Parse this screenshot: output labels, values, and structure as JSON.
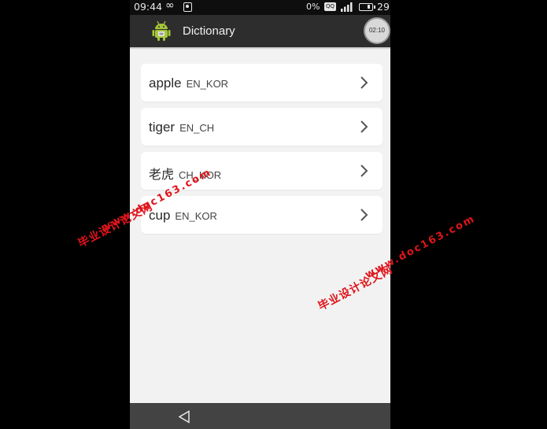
{
  "status_bar": {
    "time": "09:44",
    "infinity": "∞",
    "percent": "0%",
    "battery": "29",
    "msg_icon": "QQ"
  },
  "action_bar": {
    "title": "Dictionary",
    "timer": "02:10"
  },
  "list": {
    "items": [
      {
        "word": "apple",
        "lang": "EN_KOR"
      },
      {
        "word": "tiger",
        "lang": "EN_CH"
      },
      {
        "word": "老虎",
        "lang": "CH_KOR"
      },
      {
        "word": "cup",
        "lang": "EN_KOR"
      }
    ]
  },
  "watermarks": {
    "site_cn": "毕业设计论文网",
    "site_url": "www.doc163.com"
  },
  "colors": {
    "background": "#000000",
    "screen": "#f2f2f2",
    "action_bar": "#2d2d2d",
    "nav_bar": "#434343",
    "watermark": "#e0141b",
    "android_green": "#a4c639"
  }
}
